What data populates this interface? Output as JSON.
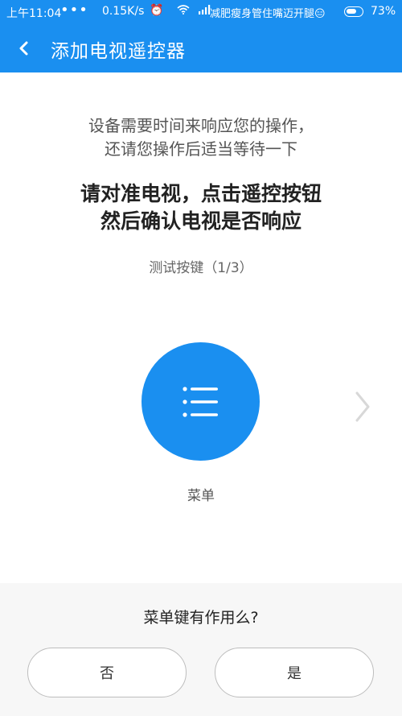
{
  "status_bar": {
    "time": "上午11:04",
    "dots": "•••",
    "speed": "0.15K/s",
    "icons": [
      "alarm-icon",
      "wifi-icon",
      "signal-icon"
    ],
    "ticker": "减肥瘦身管住嘴迈开腿😑",
    "battery_level": 0.73,
    "battery_percent": "73%"
  },
  "app_bar": {
    "title": "添加电视遥控器"
  },
  "content": {
    "hint_line1": "设备需要时间来响应您的操作，",
    "hint_line2": "还请您操作后适当等待一下",
    "instruction_line1": "请对准电视，点击遥控按钮",
    "instruction_line2": "然后确认电视是否响应",
    "test_label": "测试按键（1/3）",
    "key_name": "菜单"
  },
  "bottom": {
    "question": "菜单键有作用么?",
    "no_label": "否",
    "yes_label": "是"
  },
  "colors": {
    "primary": "#1a8ff0",
    "panel": "#f7f7f7",
    "chevron": "#d8d8d8"
  }
}
